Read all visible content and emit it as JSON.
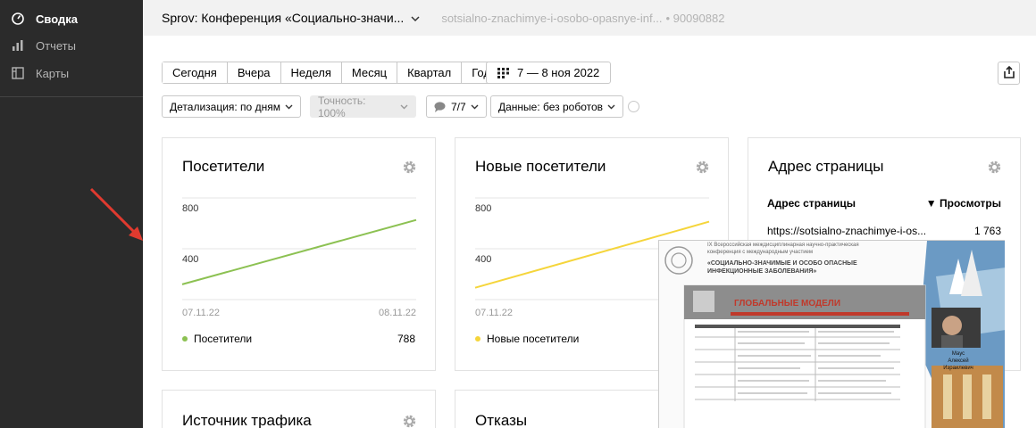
{
  "sidebar": {
    "items": [
      {
        "label": "Сводка",
        "icon": "dashboard-icon",
        "active": true
      },
      {
        "label": "Отчеты",
        "icon": "bar-chart-icon",
        "active": false
      },
      {
        "label": "Карты",
        "icon": "map-icon",
        "active": false
      }
    ]
  },
  "header": {
    "counter_name": "Sprov: Конференция «Социально-значи...",
    "counter_url": "sotsialno-znachimye-i-osobo-opasnye-inf...",
    "counter_id": "• 90090882"
  },
  "periods": [
    "Сегодня",
    "Вчера",
    "Неделя",
    "Месяц",
    "Квартал",
    "Год"
  ],
  "date_range": "7 — 8 ноя 2022",
  "controls": {
    "detail": "Детализация: по дням",
    "accuracy": "Точность: 100%",
    "segments": "7/7",
    "data": "Данные: без роботов"
  },
  "widgets": {
    "visitors": {
      "title": "Посетители",
      "legend": "Посетители",
      "value": "788",
      "y_labels": [
        "800",
        "400"
      ],
      "x_labels": [
        "07.11.22",
        "08.11.22"
      ],
      "color": "#8cc152"
    },
    "new_visitors": {
      "title": "Новые посетители",
      "legend": "Новые посетители",
      "value": "",
      "y_labels": [
        "800",
        "400"
      ],
      "x_labels": [
        "07.11.22"
      ],
      "color": "#f5d53b"
    },
    "page_address": {
      "title": "Адрес страницы",
      "col1": "Адрес страницы",
      "col2": "▼ Просмотры",
      "row_url": "https://sotsialno-znachimye-i-os...",
      "row_value": "1 763"
    },
    "traffic": {
      "title": "Источник трафика"
    },
    "bounces": {
      "title": "Отказы"
    }
  },
  "chart_data": [
    {
      "type": "line",
      "title": "Посетители",
      "x": [
        "07.11.22",
        "08.11.22"
      ],
      "series": [
        {
          "name": "Посетители",
          "values": [
            390,
            770
          ]
        }
      ],
      "ylim": [
        300,
        900
      ]
    },
    {
      "type": "line",
      "title": "Новые посетители",
      "x": [
        "07.11.22",
        "08.11.22"
      ],
      "series": [
        {
          "name": "Новые посетители",
          "values": [
            370,
            760
          ]
        }
      ],
      "ylim": [
        300,
        900
      ]
    }
  ],
  "overlay": {
    "header_line1": "IX Всероссийская междисциплинарная научно-практическая",
    "header_line2": "конференция с международным участием",
    "header_line3": "«СОЦИАЛЬНО-ЗНАЧИМЫЕ И ОСОБО ОПАСНЫЕ",
    "header_line4": "ИНФЕКЦИОННЫЕ ЗАБОЛЕВАНИЯ»",
    "slide_title": "ГЛОБАЛЬНЫЕ МОДЕЛИ",
    "speaker_line1": "Маус",
    "speaker_line2": "Алексей",
    "speaker_line3": "Израилевич"
  }
}
